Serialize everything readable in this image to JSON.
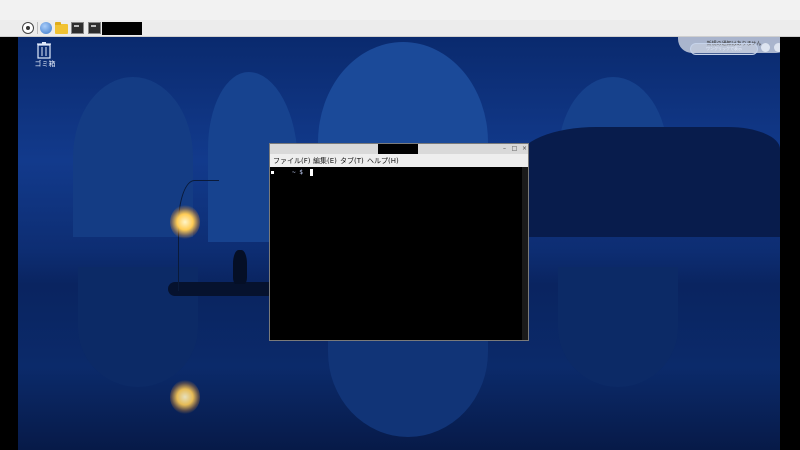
{
  "taskbar": {
    "items": [
      "menu-icon",
      "browser-icon",
      "folder-icon",
      "terminal-icon",
      "terminal-icon"
    ]
  },
  "desktop": {
    "trash_label": "ゴミ箱",
    "notification_text": "新規の通知はありません",
    "pill_label": "ワンクリックで表示"
  },
  "terminal": {
    "menu": [
      "ファイル(F)",
      "編集(E)",
      "タブ(T)",
      "ヘルプ(H)"
    ],
    "prompt": "~ $"
  },
  "colors": {
    "taskbar_bg": "#ececec",
    "desktop_accent": "#123a8c",
    "terminal_bg": "#000000",
    "lantern_glow": "#ffcc55"
  }
}
